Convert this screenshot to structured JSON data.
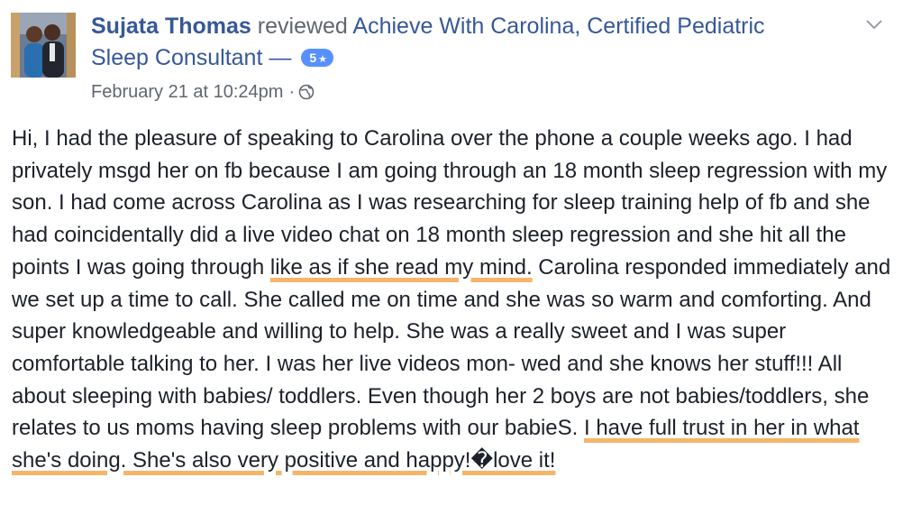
{
  "post": {
    "author": {
      "name": "Sujata Thomas",
      "avatar_icon": "profile-photo"
    },
    "action": "reviewed",
    "page_name": "Achieve With Carolina, Certified Pediatric Sleep Consultant",
    "separator": "—",
    "rating": {
      "value": "5",
      "icon": "star-icon",
      "color": "#5890ff"
    },
    "timestamp": "February 21 at 10:24pm",
    "meta_separator": "·",
    "privacy_icon": "globe-icon",
    "menu_icon": "chevron-down-icon",
    "body": {
      "segments": [
        {
          "text": "Hi, I had the pleasure of speaking to Carolina over the phone a couple weeks ago. I had privately msgd her on fb because I am going through an 18 month sleep regression with my son. I had come across Carolina as I was researching for sleep training help of fb and she had coincidentally did a live video chat on 18 month sleep regression and she hit all the points I was going through ",
          "highlighted": false
        },
        {
          "text": "like as if she read my mind.",
          "highlighted": true
        },
        {
          "text": " Carolina responded immediately and we set up a time to call. She called me on time and she was so warm and comforting. And super knowledgeable and willing to help. She was a really sweet and I was super comfortable talking to her. I was her live videos mon- wed and she knows her stuff!!! All about sleeping with babies/ toddlers. Even though her 2 boys are not babies/toddlers, she relates to us moms having sleep problems with our babieS. ",
          "highlighted": false
        },
        {
          "text": "I have full trust in her in what she's doing. She's also very positive and happy!�love it!",
          "highlighted": true
        }
      ]
    },
    "colors": {
      "link": "#365899",
      "secondary_text": "#616770",
      "body_text": "#1d2129",
      "highlight_underline": "#f5b56a"
    }
  }
}
